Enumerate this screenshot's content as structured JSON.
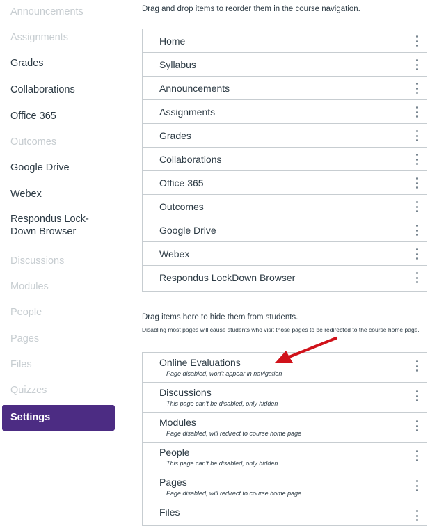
{
  "sidebar": {
    "items": [
      {
        "label": "Announcements",
        "state": "dim"
      },
      {
        "label": "Assignments",
        "state": "dim"
      },
      {
        "label": "Grades",
        "state": "enabled"
      },
      {
        "label": "Collaborations",
        "state": "enabled"
      },
      {
        "label": "Office 365",
        "state": "enabled"
      },
      {
        "label": "Outcomes",
        "state": "dim"
      },
      {
        "label": "Google Drive",
        "state": "enabled"
      },
      {
        "label": "Webex",
        "state": "enabled"
      },
      {
        "label": "Respondus Lock-",
        "label2": "Down Browser",
        "state": "enabled"
      },
      {
        "label": "Discussions",
        "state": "dim"
      },
      {
        "label": "Modules",
        "state": "dim"
      },
      {
        "label": "People",
        "state": "dim"
      },
      {
        "label": "Pages",
        "state": "dim"
      },
      {
        "label": "Files",
        "state": "dim"
      },
      {
        "label": "Quizzes",
        "state": "dim"
      },
      {
        "label": "Settings",
        "state": "active"
      }
    ],
    "active_color": "#4c2c83"
  },
  "main": {
    "instruction": "Drag and drop items to reorder them in the course navigation.",
    "enabled_items": [
      "Home",
      "Syllabus",
      "Announcements",
      "Assignments",
      "Grades",
      "Collaborations",
      "Office 365",
      "Outcomes",
      "Google Drive",
      "Webex",
      "Respondus LockDown Browser"
    ],
    "hide_title": "Drag items here to hide them from students.",
    "hide_note": "Disabling most pages will cause students who visit those pages to be redirected to the course home page.",
    "hidden_items": [
      {
        "label": "Online Evaluations",
        "sub": "Page disabled, won't appear in navigation"
      },
      {
        "label": "Discussions",
        "sub": "This page can't be disabled, only hidden"
      },
      {
        "label": "Modules",
        "sub": "Page disabled, will redirect to course home page"
      },
      {
        "label": "People",
        "sub": "This page can't be disabled, only hidden"
      },
      {
        "label": "Pages",
        "sub": "Page disabled, will redirect to course home page"
      },
      {
        "label": "Files",
        "sub": ""
      }
    ],
    "arrow_color": "#d0121a"
  }
}
